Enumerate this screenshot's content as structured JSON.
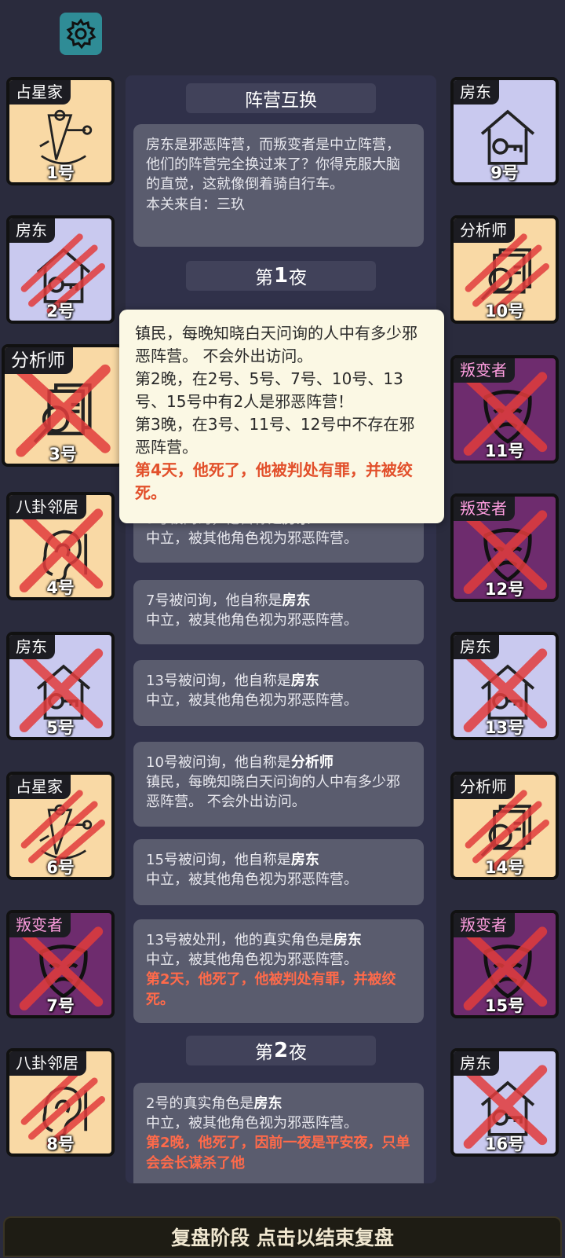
{
  "settings": {
    "icon": "gear-icon"
  },
  "header": {
    "title": "阵营互换"
  },
  "intro": {
    "text": "房东是邪恶阵营，而叛变者是中立阵营，他们的阵营完全换过来了？你得克服大脑的直觉，这就像倒着骑自行车。",
    "source": "本关来自：三玖"
  },
  "nights": [
    {
      "prefix": "第",
      "number": "1",
      "suffix": "夜"
    },
    {
      "prefix": "第",
      "number": "2",
      "suffix": "夜"
    }
  ],
  "popup": {
    "lines": [
      "镇民，每晚知晓白天问询的人中有多少邪恶阵营。 不会外出访问。",
      "第2晚，在2号、5号、7号、10号、13号、15号中有2人是邪恶阵营！",
      "第3晚，在3号、11号、12号中不存在邪恶阵营。"
    ],
    "death": "第4天，他死了，他被判处有罪，并被绞死。"
  },
  "entries": [
    {
      "head": "5号被问询，他自称是",
      "role": "房东",
      "body": "中立，被其他角色视为邪恶阵营。",
      "death": ""
    },
    {
      "head": "7号被问询，他自称是",
      "role": "房东",
      "body": "中立，被其他角色视为邪恶阵营。",
      "death": ""
    },
    {
      "head": "13号被问询，他自称是",
      "role": "房东",
      "body": "中立，被其他角色视为邪恶阵营。",
      "death": ""
    },
    {
      "head": "10号被问询，他自称是",
      "role": "分析师",
      "body": "镇民，每晚知晓白天问询的人中有多少邪恶阵营。 不会外出访问。",
      "death": ""
    },
    {
      "head": "15号被问询，他自称是",
      "role": "房东",
      "body": "中立，被其他角色视为邪恶阵营。",
      "death": ""
    },
    {
      "head": "13号被处刑，他的真实角色是",
      "role": "房东",
      "body": "中立，被其他角色视为邪恶阵营。",
      "death": "第2天，他死了，他被判处有罪，并被绞死。"
    },
    {
      "head": "2号的真实角色是",
      "role": "房东",
      "body": "中立，被其他角色视为邪恶阵营。",
      "death": "第2晚，他死了，因前一夜是平安夜，只单会会长谋杀了他"
    }
  ],
  "players": [
    {
      "seat": "1号",
      "role": "占星家",
      "icon": "sextant-icon",
      "status": "alive"
    },
    {
      "seat": "2号",
      "role": "房东",
      "icon": "house-key-icon",
      "status": "night-killed"
    },
    {
      "seat": "3号",
      "role": "分析师",
      "icon": "analyst-icon",
      "status": "executed"
    },
    {
      "seat": "4号",
      "role": "八卦邻居",
      "icon": "ear-icon",
      "status": "executed"
    },
    {
      "seat": "5号",
      "role": "房东",
      "icon": "house-key-icon",
      "status": "executed"
    },
    {
      "seat": "6号",
      "role": "占星家",
      "icon": "sextant-icon",
      "status": "night-killed"
    },
    {
      "seat": "7号",
      "role": "叛变者",
      "icon": "mask-icon",
      "status": "executed"
    },
    {
      "seat": "8号",
      "role": "八卦邻居",
      "icon": "ear-icon",
      "status": "night-killed"
    },
    {
      "seat": "9号",
      "role": "房东",
      "icon": "house-key-icon",
      "status": "alive"
    },
    {
      "seat": "10号",
      "role": "分析师",
      "icon": "analyst-icon",
      "status": "night-killed"
    },
    {
      "seat": "11号",
      "role": "叛变者",
      "icon": "mask-icon",
      "status": "executed"
    },
    {
      "seat": "12号",
      "role": "叛变者",
      "icon": "mask-icon",
      "status": "executed"
    },
    {
      "seat": "13号",
      "role": "房东",
      "icon": "house-key-icon",
      "status": "executed"
    },
    {
      "seat": "14号",
      "role": "分析师",
      "icon": "analyst-icon",
      "status": "night-killed"
    },
    {
      "seat": "15号",
      "role": "叛变者",
      "icon": "mask-icon",
      "status": "executed"
    },
    {
      "seat": "16号",
      "role": "房东",
      "icon": "house-key-icon",
      "status": "executed"
    }
  ],
  "footer": {
    "label": "复盘阶段 点击以结束复盘"
  },
  "colors": {
    "background": "#2a2b3d",
    "peach_card": "#f9d9a5",
    "lavender_card": "#c9c9ef",
    "plum_card": "#6e2c6e",
    "death_text": "#ff6a4a",
    "evil_tag": "#ff9ee0",
    "mark_red": "#e23c3c"
  }
}
